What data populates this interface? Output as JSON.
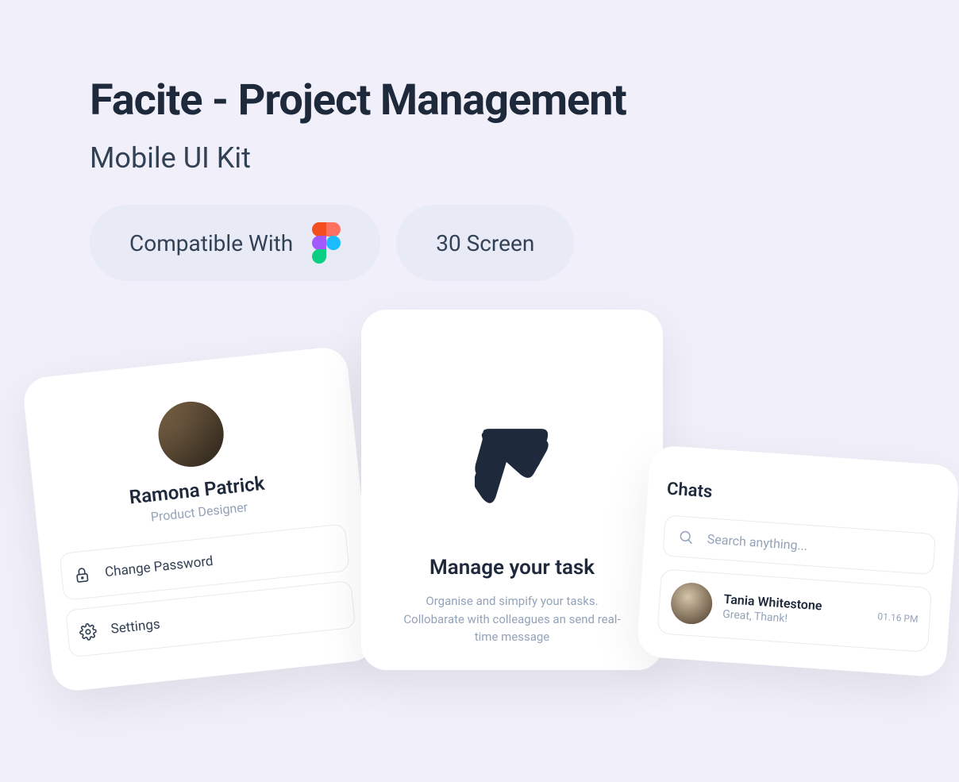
{
  "header": {
    "title": "Facite - Project Management",
    "subtitle": "Mobile UI Kit"
  },
  "pills": {
    "compatible_label": "Compatible With",
    "screens_label": "30 Screen"
  },
  "profile": {
    "name": "Ramona Patrick",
    "role": "Product Designer",
    "items": [
      {
        "label": "Change Password"
      },
      {
        "label": "Settings"
      }
    ]
  },
  "onboard": {
    "title": "Manage your task",
    "desc": "Organise and simpify your tasks. Collobarate with colleagues an send real-time message"
  },
  "chats": {
    "title": "Chats",
    "search_placeholder": "Search anything...",
    "item": {
      "name": "Tania Whitestone",
      "msg": "Great, Thank!",
      "time": "01.16 PM"
    }
  }
}
